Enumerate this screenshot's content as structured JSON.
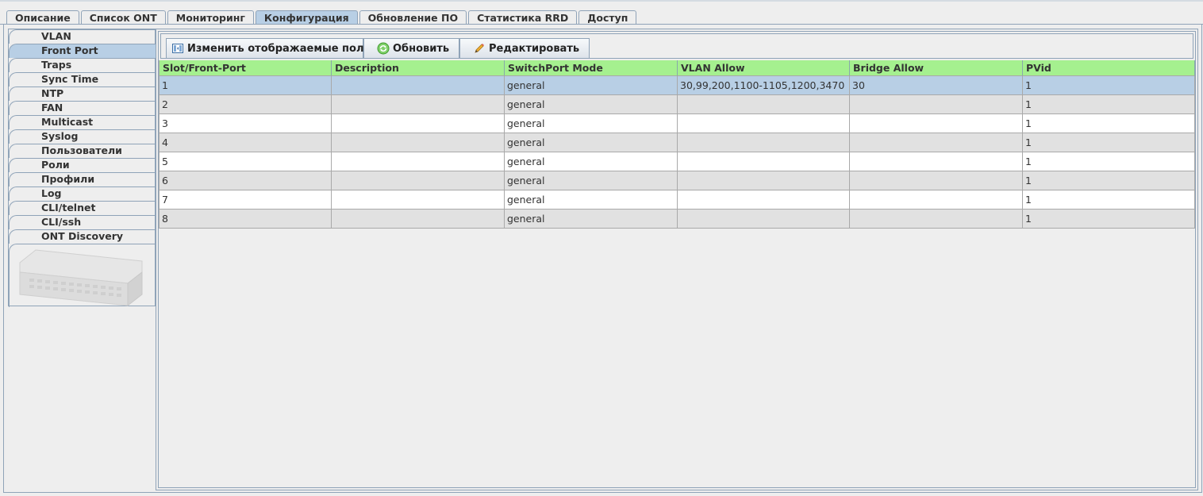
{
  "tabs": [
    {
      "label": "Описание"
    },
    {
      "label": "Список ONT"
    },
    {
      "label": "Мониторинг"
    },
    {
      "label": "Конфигурация"
    },
    {
      "label": "Обновление ПО"
    },
    {
      "label": "Статистика RRD"
    },
    {
      "label": "Доступ"
    }
  ],
  "sidebar": {
    "items": [
      {
        "label": "VLAN"
      },
      {
        "label": "Front Port"
      },
      {
        "label": "Traps"
      },
      {
        "label": "Sync Time"
      },
      {
        "label": "NTP"
      },
      {
        "label": "FAN"
      },
      {
        "label": "Multicast"
      },
      {
        "label": "Syslog"
      },
      {
        "label": "Пользователи"
      },
      {
        "label": "Роли"
      },
      {
        "label": "Профили"
      },
      {
        "label": "Log"
      },
      {
        "label": "CLI/telnet"
      },
      {
        "label": "CLI/ssh"
      },
      {
        "label": "ONT Discovery"
      }
    ]
  },
  "toolbar": {
    "change_fields_label": "Изменить отображаемые поля",
    "refresh_label": "Обновить",
    "edit_label": "Редактировать"
  },
  "table": {
    "columns": [
      "Slot/Front-Port",
      "Description",
      "SwitchPort Mode",
      "VLAN Allow",
      "Bridge Allow",
      "PVid"
    ],
    "rows": [
      [
        "1",
        "",
        "general",
        "30,99,200,1100-1105,1200,3470",
        "30",
        "1"
      ],
      [
        "2",
        "",
        "general",
        "",
        "",
        "1"
      ],
      [
        "3",
        "",
        "general",
        "",
        "",
        "1"
      ],
      [
        "4",
        "",
        "general",
        "",
        "",
        "1"
      ],
      [
        "5",
        "",
        "general",
        "",
        "",
        "1"
      ],
      [
        "6",
        "",
        "general",
        "",
        "",
        "1"
      ],
      [
        "7",
        "",
        "general",
        "",
        "",
        "1"
      ],
      [
        "8",
        "",
        "general",
        "",
        "",
        "1"
      ]
    ]
  },
  "colors": {
    "header_bg": "#a5f08f",
    "selected_bg": "#b8cfe5",
    "border": "#8fa3b8"
  }
}
